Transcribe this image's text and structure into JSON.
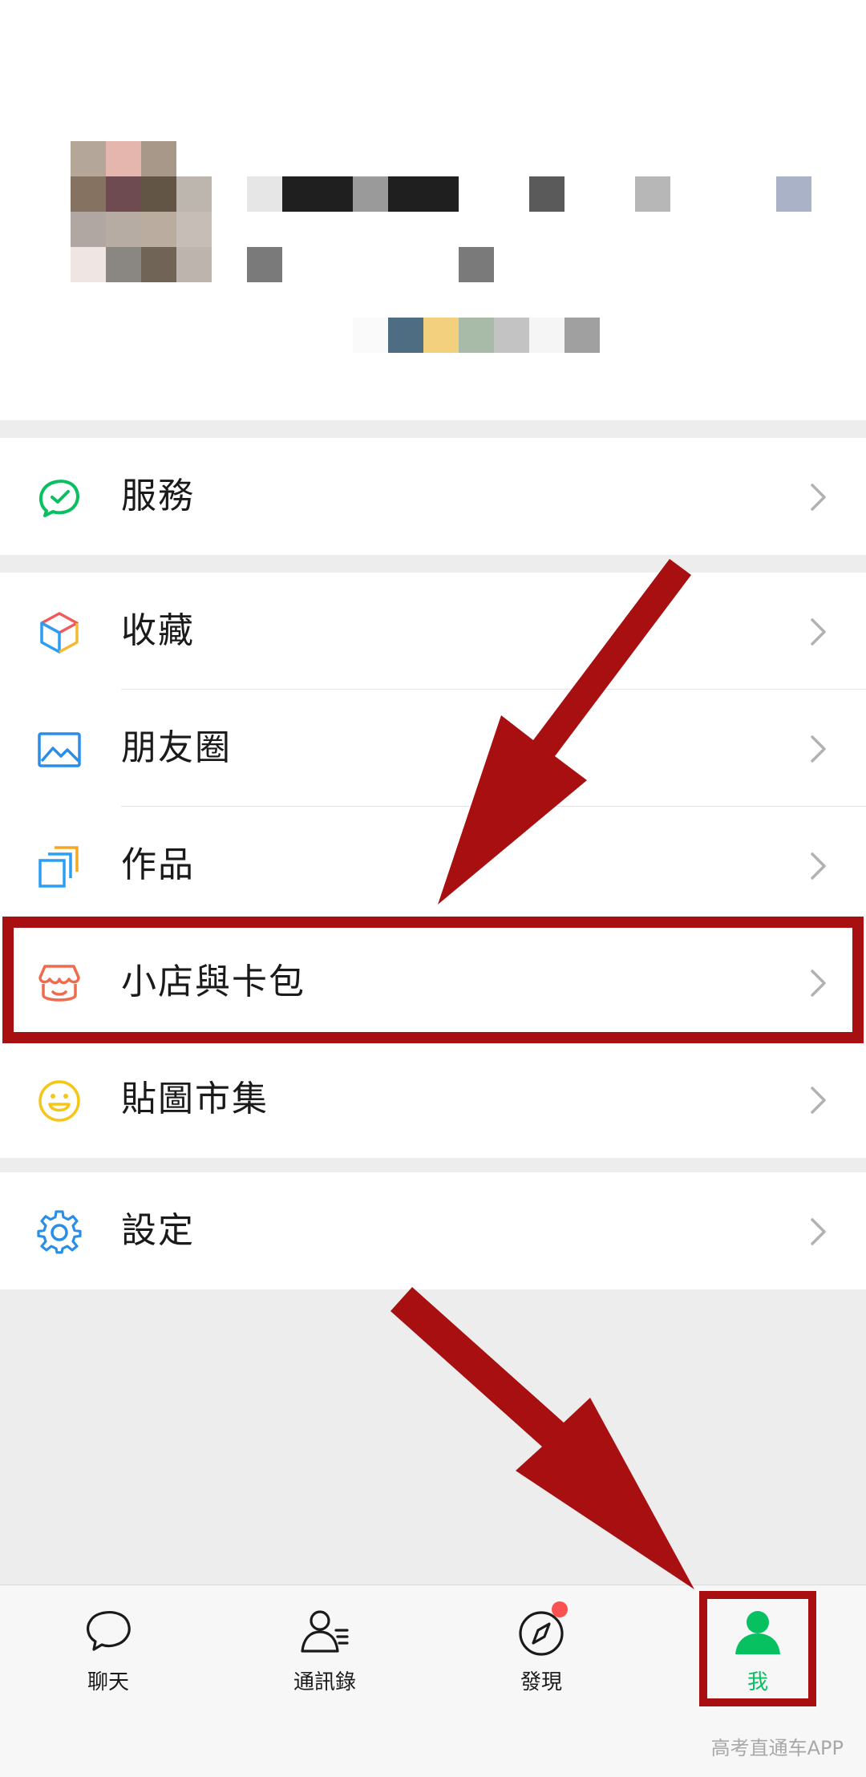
{
  "menu": {
    "services": "服務",
    "favorites": "收藏",
    "moments": "朋友圈",
    "works": "作品",
    "shop_and_cards": "小店與卡包",
    "sticker_gallery": "貼圖市集",
    "settings": "設定"
  },
  "tabbar": {
    "chats": "聊天",
    "contacts": "通訊錄",
    "discover": "發現",
    "me": "我",
    "active_tab": "我",
    "discover_has_dot": true
  },
  "watermark": "高考直通车APP",
  "colors": {
    "accent_green": "#07c160",
    "annotation_red": "#a80f11",
    "badge_red": "#fa5151"
  },
  "icons": {
    "services": "services-check-icon",
    "favorites": "cube-icon",
    "moments": "picture-icon",
    "works": "stacked-cards-icon",
    "shop_and_cards": "shop-awning-icon",
    "sticker_gallery": "smiley-icon",
    "settings": "gear-icon"
  }
}
